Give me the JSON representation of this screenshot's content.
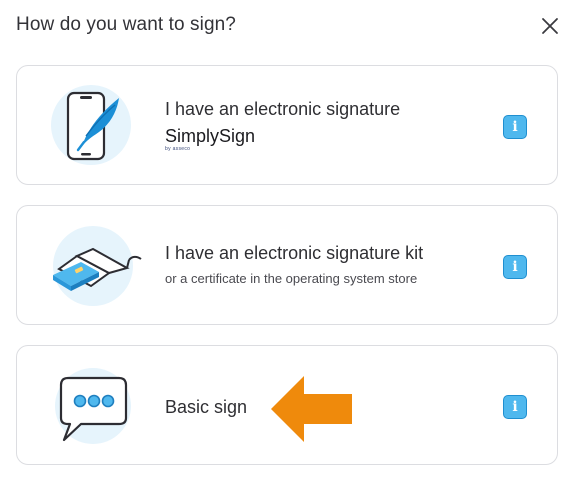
{
  "dialog": {
    "title": "How do you want to sign?",
    "close_icon": "close-icon"
  },
  "options": [
    {
      "title": "I have an electronic signature",
      "brand": "SimplySign",
      "brand_tag": "by asseco",
      "illustration": "phone-feather-icon",
      "info_label": "i"
    },
    {
      "title": "I have an electronic signature kit",
      "subtitle": "or a certificate in the operating system store",
      "illustration": "card-reader-icon",
      "info_label": "i"
    },
    {
      "title": "Basic sign",
      "illustration": "chat-bubble-icon",
      "info_label": "i"
    }
  ],
  "annotation": {
    "icon": "arrow-left-icon",
    "color": "#ef8a0c"
  },
  "colors": {
    "accent": "#4fb8ee",
    "illustration_bg": "#e6f4fc",
    "arrow": "#ef8a0c"
  }
}
